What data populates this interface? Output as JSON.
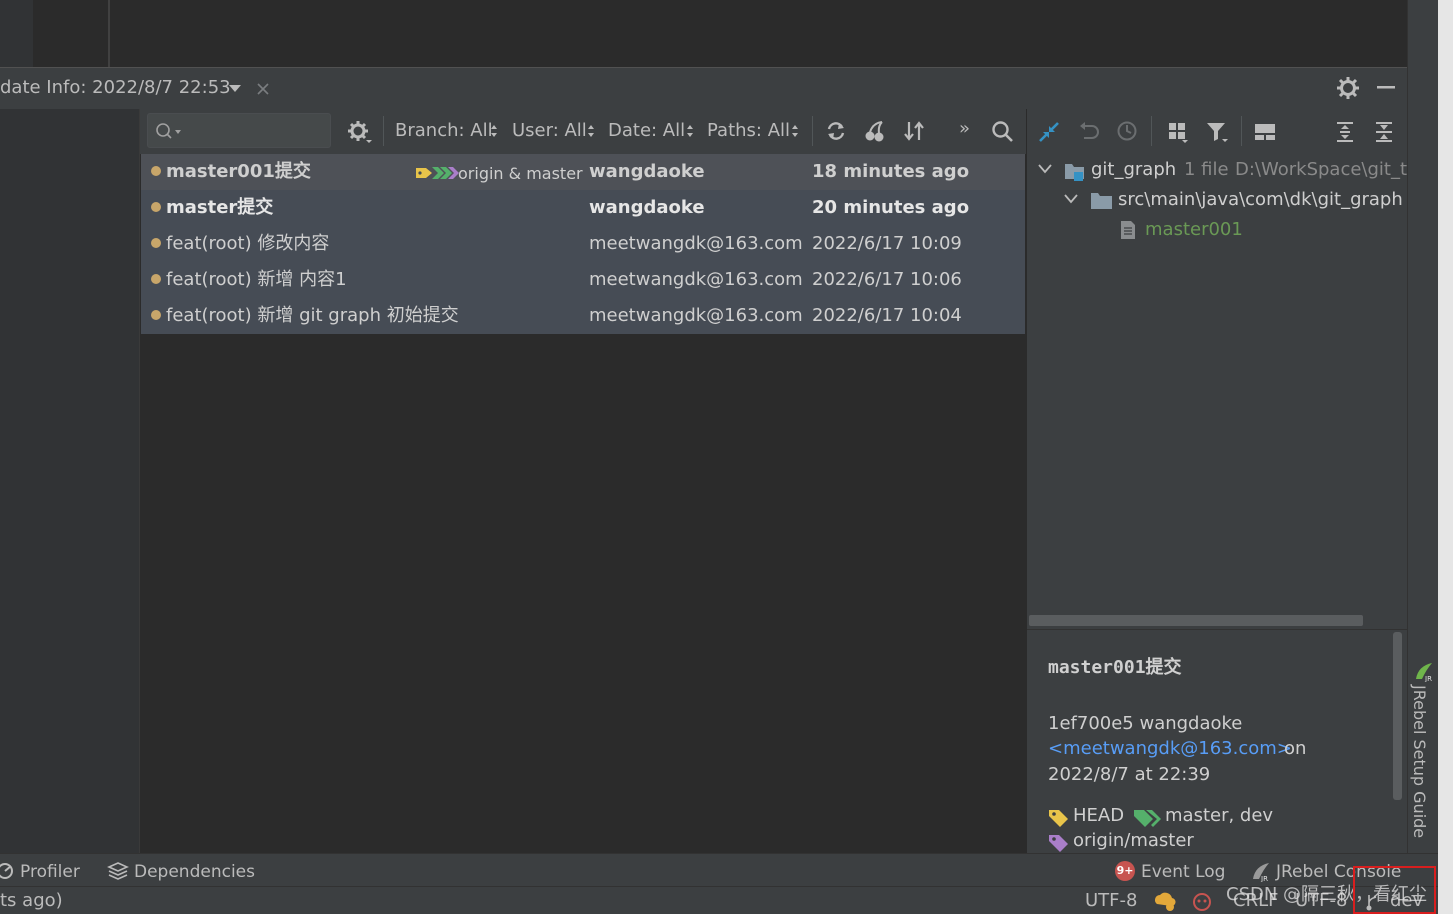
{
  "tool_window": {
    "tab_title": "date Info: 2022/8/7 22:53"
  },
  "toolbar": {
    "search_placeholder": "",
    "filters": [
      {
        "label": "Branch: All"
      },
      {
        "label": "User: All"
      },
      {
        "label": "Date: All"
      },
      {
        "label": "Paths: All"
      }
    ],
    "more_label": "»"
  },
  "commits": [
    {
      "message": "master001提交",
      "refs": "origin & master",
      "author": "wangdaoke",
      "date": "18 minutes ago",
      "bold": true,
      "selected": true
    },
    {
      "message": "master提交",
      "refs": "",
      "author": "wangdaoke",
      "date": "20 minutes ago",
      "bold": true,
      "selected": false
    },
    {
      "message": "feat(root) 修改内容",
      "refs": "",
      "author": "meetwangdk@163.com",
      "date": "2022/6/17 10:09",
      "bold": false,
      "selected": false
    },
    {
      "message": "feat(root) 新增 内容1",
      "refs": "",
      "author": "meetwangdk@163.com",
      "date": "2022/6/17 10:06",
      "bold": false,
      "selected": false
    },
    {
      "message": "feat(root) 新增 git graph 初始提交",
      "refs": "",
      "author": "meetwangdk@163.com",
      "date": "2022/6/17 10:04",
      "bold": false,
      "selected": false
    }
  ],
  "changes_tree": {
    "root": {
      "name": "git_graph",
      "count": "1 file",
      "path": "D:\\WorkSpace\\git_te"
    },
    "folder": {
      "name": "src\\main\\java\\com\\dk\\git_graph"
    },
    "file": {
      "name": "master001",
      "color": "#6a9955"
    }
  },
  "details": {
    "title": "master001提交",
    "hash_author": "1ef700e5 wangdaoke",
    "email": "<meetwangdk@163.com>",
    "on_label": "on",
    "datetime": "2022/8/7 at 22:39",
    "refs_line1_head": "HEAD",
    "refs_line1_branches": "master, dev",
    "refs_line2": "origin/master"
  },
  "right_stripe": {
    "jrebel_setup_guide": "JRebel Setup Guide"
  },
  "bottom_tabs": [
    {
      "label": "Profiler"
    },
    {
      "label": "Dependencies"
    },
    {
      "label": "Event Log",
      "badge": "9+"
    },
    {
      "label": "JRebel Console"
    }
  ],
  "status_bar": {
    "left_text": "ts ago)",
    "encoding": "UTF-8",
    "line_sep": "CRLF",
    "encoding2": "UTF-8",
    "branch": "dev",
    "watermark": "CSDN @隔三秋，看红尘"
  },
  "colors": {
    "tag_yellow": "#e8c44a",
    "tag_green": "#55b06b",
    "tag_purple": "#a97ec9",
    "link_blue": "#589df6",
    "graph_gold": "#c8a66a"
  }
}
